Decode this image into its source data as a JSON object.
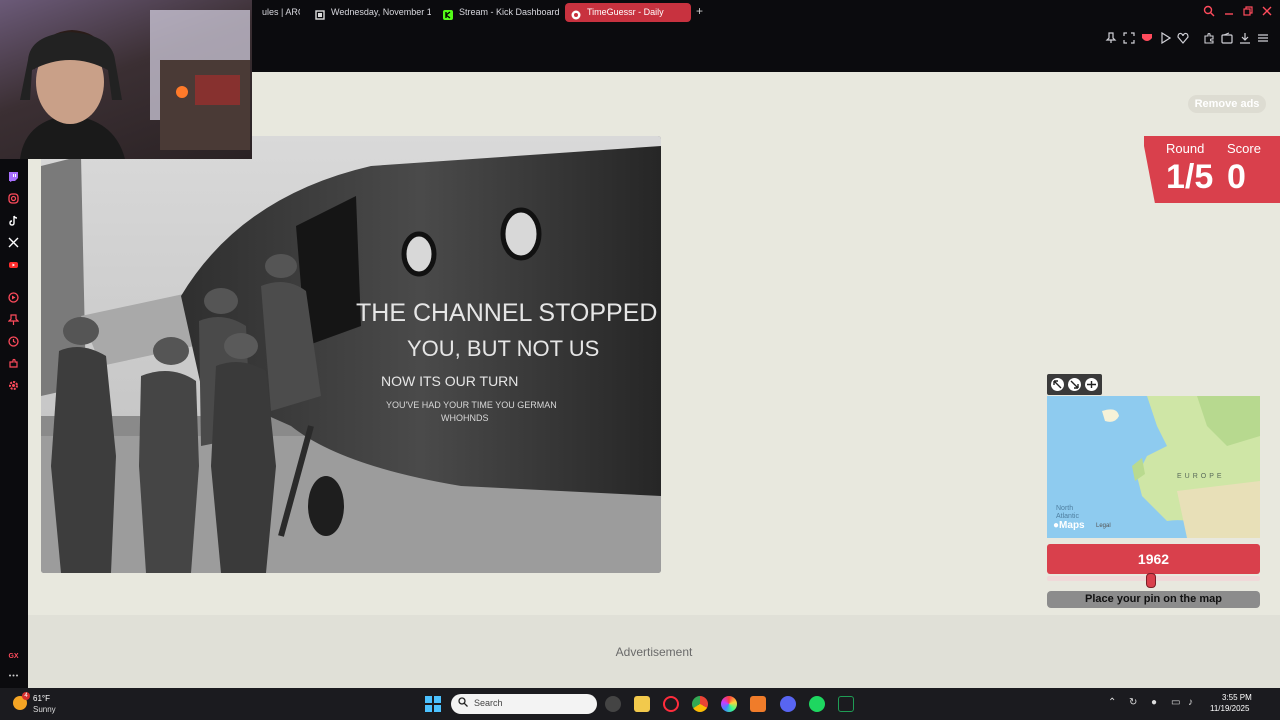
{
  "browser": {
    "tabs": [
      {
        "label": "ules | ARC R",
        "icon": "page-icon",
        "active": false
      },
      {
        "label": "Wednesday, November 1",
        "icon": "calendar-icon",
        "active": false
      },
      {
        "label": "Stream - Kick Dashboard",
        "icon": "kick-icon",
        "active": false
      },
      {
        "label": "TimeGuessr - Daily",
        "icon": "globe-icon",
        "active": true
      }
    ],
    "new_tab": "+"
  },
  "page": {
    "remove_ads": "Remove ads",
    "photo_text": {
      "line1": "THE CHANNEL STOPPED",
      "line2": "YOU, BUT NOT US",
      "line3": "NOW ITS OUR TURN",
      "line4": "YOU'VE HAD YOUR TIME YOU GERMAN",
      "line5": "WHOHNDS"
    },
    "round_label": "Round",
    "round_value": "1/5",
    "score_label": "Score",
    "score_value": "0",
    "map": {
      "region_label": "EUROPE",
      "ocean_label": "North\nAtlantic",
      "brand": "Maps",
      "legal": "Legal"
    },
    "year": "1962",
    "year_slider_fraction": 0.49,
    "pin_button": "Place your pin on the map",
    "advertisement": "Advertisement"
  },
  "taskbar": {
    "weather_badge": "4",
    "temperature": "61°F",
    "condition": "Sunny",
    "search_placeholder": "Search",
    "time": "3:55 PM",
    "date": "11/19/2025"
  },
  "colors": {
    "accent": "#d9404c",
    "page_bg": "#e8e8de",
    "chrome": "#0b0b0e"
  }
}
